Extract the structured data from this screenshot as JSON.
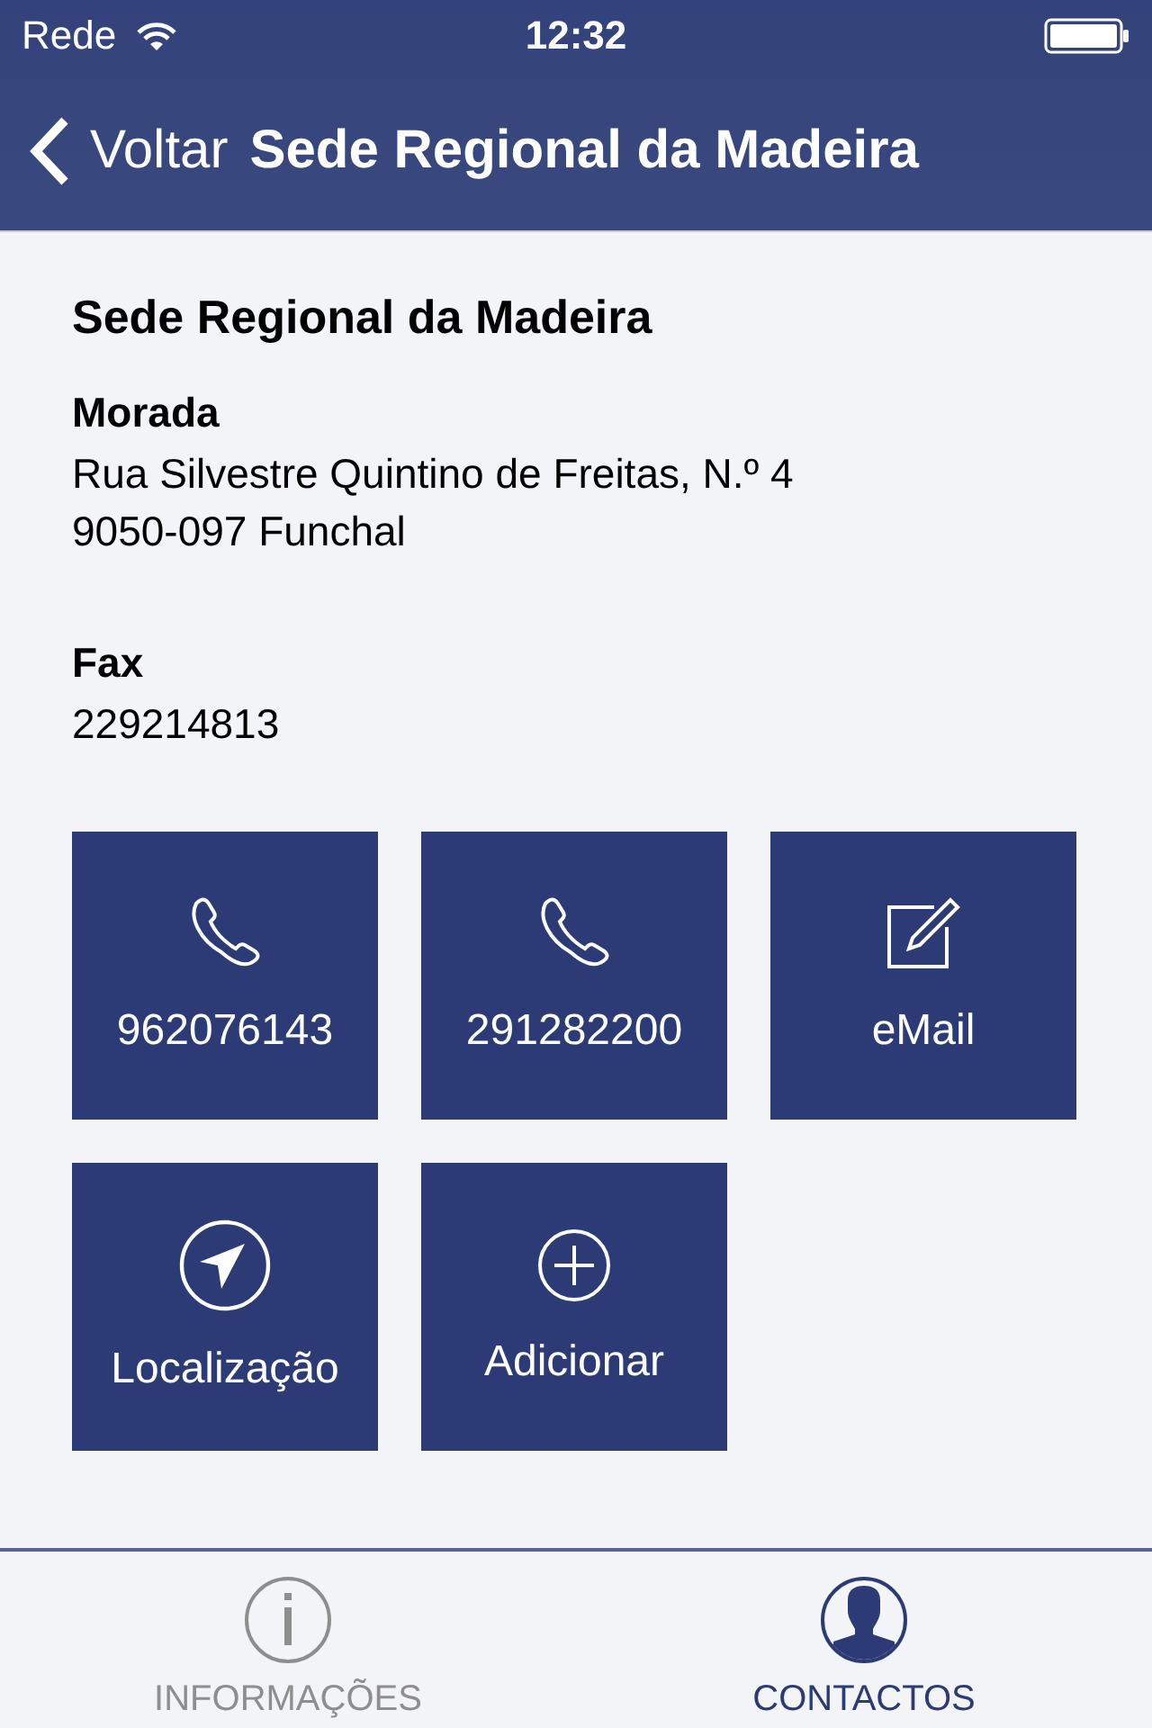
{
  "status_bar": {
    "carrier": "Rede",
    "time": "12:32"
  },
  "nav_bar": {
    "back": "Voltar",
    "title": "Sede Regional da Madeira"
  },
  "office": {
    "name": "Sede Regional da Madeira",
    "sections": [
      {
        "label": "Morada",
        "lines": [
          "Rua Silvestre Quintino de Freitas, N.º 4",
          "9050-097 Funchal"
        ]
      },
      {
        "label": "Fax",
        "lines": [
          "229214813"
        ]
      }
    ]
  },
  "actions": [
    {
      "kind": "phone",
      "label": "962076143"
    },
    {
      "kind": "phone",
      "label": "291282200"
    },
    {
      "kind": "email",
      "label": "eMail"
    },
    {
      "kind": "location",
      "label": "Localização"
    },
    {
      "kind": "add",
      "label": "Adicionar"
    }
  ],
  "tabs": [
    {
      "kind": "info",
      "label": "INFORMAÇÕES",
      "selected": false
    },
    {
      "kind": "contacts",
      "label": "CONTACTOS",
      "selected": true
    }
  ]
}
